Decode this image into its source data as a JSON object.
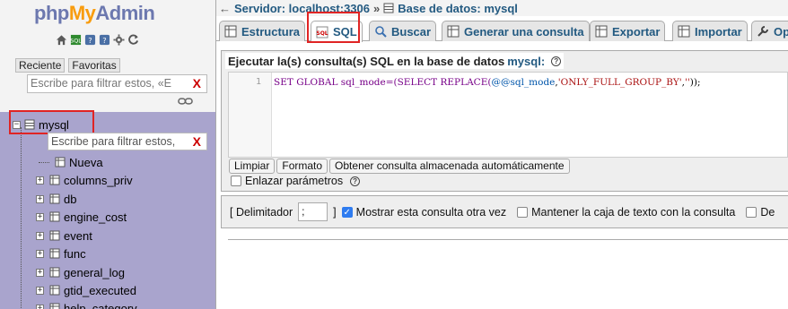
{
  "logo": {
    "php": "php",
    "my": "My",
    "admin": "Admin"
  },
  "sidebar": {
    "quick_icons": [
      "home-icon",
      "exit-icon",
      "docs-icon",
      "sql-docs-icon",
      "settings-icon",
      "reload-icon"
    ],
    "tabs": [
      "Reciente",
      "Favoritas"
    ],
    "filter_placeholder": "Escribe para filtrar estos, «E",
    "filter_clear": "X",
    "db_name": "mysql",
    "db_filter_placeholder": "Escribe para filtrar estos,",
    "db_filter_clear": "X",
    "tables": [
      "Nueva",
      "columns_priv",
      "db",
      "engine_cost",
      "event",
      "func",
      "general_log",
      "gtid_executed",
      "help_category"
    ]
  },
  "breadcrumb": {
    "server": "Servidor: localhost:3306",
    "sep": "»",
    "database": "Base de datos: mysql"
  },
  "tabs": [
    "Estructura",
    "SQL",
    "Buscar",
    "Generar una consulta",
    "Exportar",
    "Importar",
    "Operaciones"
  ],
  "active_tab": "SQL",
  "query_panel": {
    "legend": "Ejecutar la(s) consulta(s) SQL en la base de datos",
    "legend_db": "mysql:",
    "line_number": "1",
    "code": {
      "part1": "SET GLOBAL sql_mode=(",
      "part2": "SELECT REPLACE(",
      "part3": "@@sql_mode",
      "part4": ",",
      "part5": "'ONLY_FULL_GROUP_BY'",
      "part6": ",",
      "part7": "''",
      "part8": "));"
    },
    "buttons": [
      "Limpiar",
      "Formato",
      "Obtener consulta almacenada automáticamente"
    ],
    "bind_params": "Enlazar parámetros"
  },
  "options": {
    "delimiter_label": "[ Delimitador",
    "delimiter_value": ";",
    "delimiter_close": "]",
    "show_query": "Mostrar esta consulta otra vez",
    "keep_box": "Mantener la caja de texto con la consulta",
    "next_option": "De"
  },
  "colors": {
    "accent": "#235a81",
    "highlight": "#e02424",
    "sidebar_tree": "#a9a4cd",
    "checkbox_on": "#2f7cf0"
  }
}
